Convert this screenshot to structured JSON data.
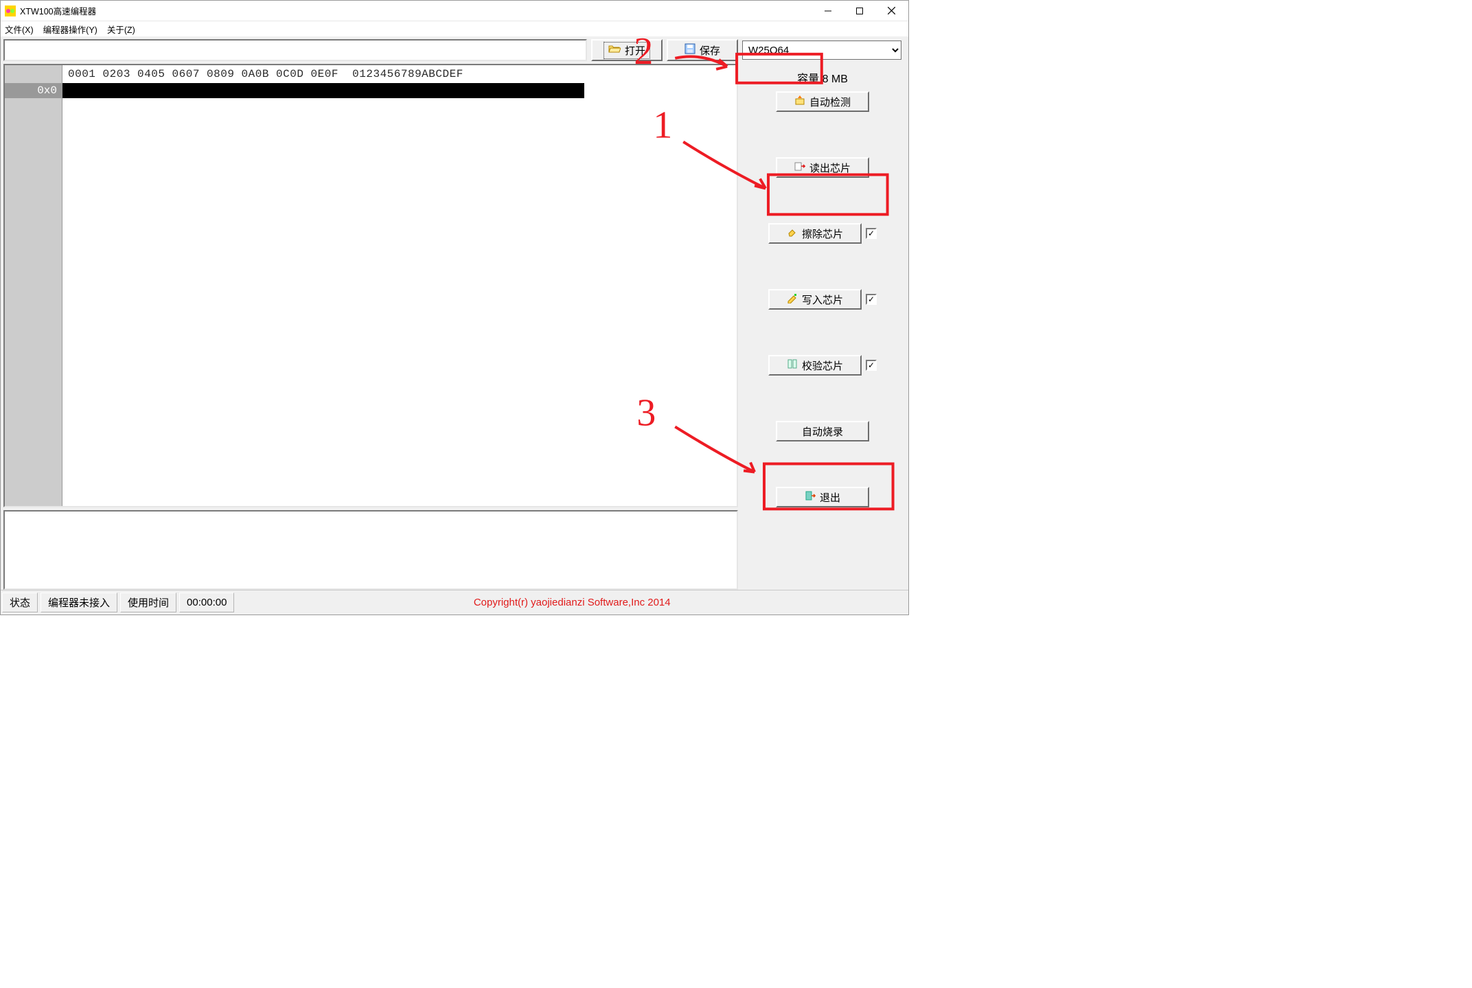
{
  "window": {
    "title": "XTW100高速编程器"
  },
  "menu": {
    "file": "文件(X)",
    "programmer": "编程器操作(Y)",
    "about": "关于(Z)"
  },
  "toolbar": {
    "open_label": "打开",
    "save_label": "保存",
    "filepath_value": ""
  },
  "hex": {
    "header": "0001 0203 0405 0607 0809 0A0B 0C0D 0E0F  0123456789ABCDEF",
    "row0_addr": "0x0",
    "row0_data": ""
  },
  "sidebar": {
    "chip_selected": "W25Q64",
    "capacity_label": "容量",
    "capacity_value": "8 MB",
    "auto_detect": "自动检测",
    "read_chip": "读出芯片",
    "erase_chip": "擦除芯片",
    "write_chip": "写入芯片",
    "verify_chip": "校验芯片",
    "auto_burn": "自动烧录",
    "exit": "退出",
    "erase_checked": true,
    "write_checked": true,
    "verify_checked": true
  },
  "statusbar": {
    "status_label": "状态",
    "connection": "编程器未接入",
    "time_label": "使用时间",
    "time_value": "00:00:00",
    "copyright": "Copyright(r) yaojiedianzi Software,Inc 2014"
  },
  "annotations": {
    "n1": "1",
    "n2": "2",
    "n3": "3"
  }
}
